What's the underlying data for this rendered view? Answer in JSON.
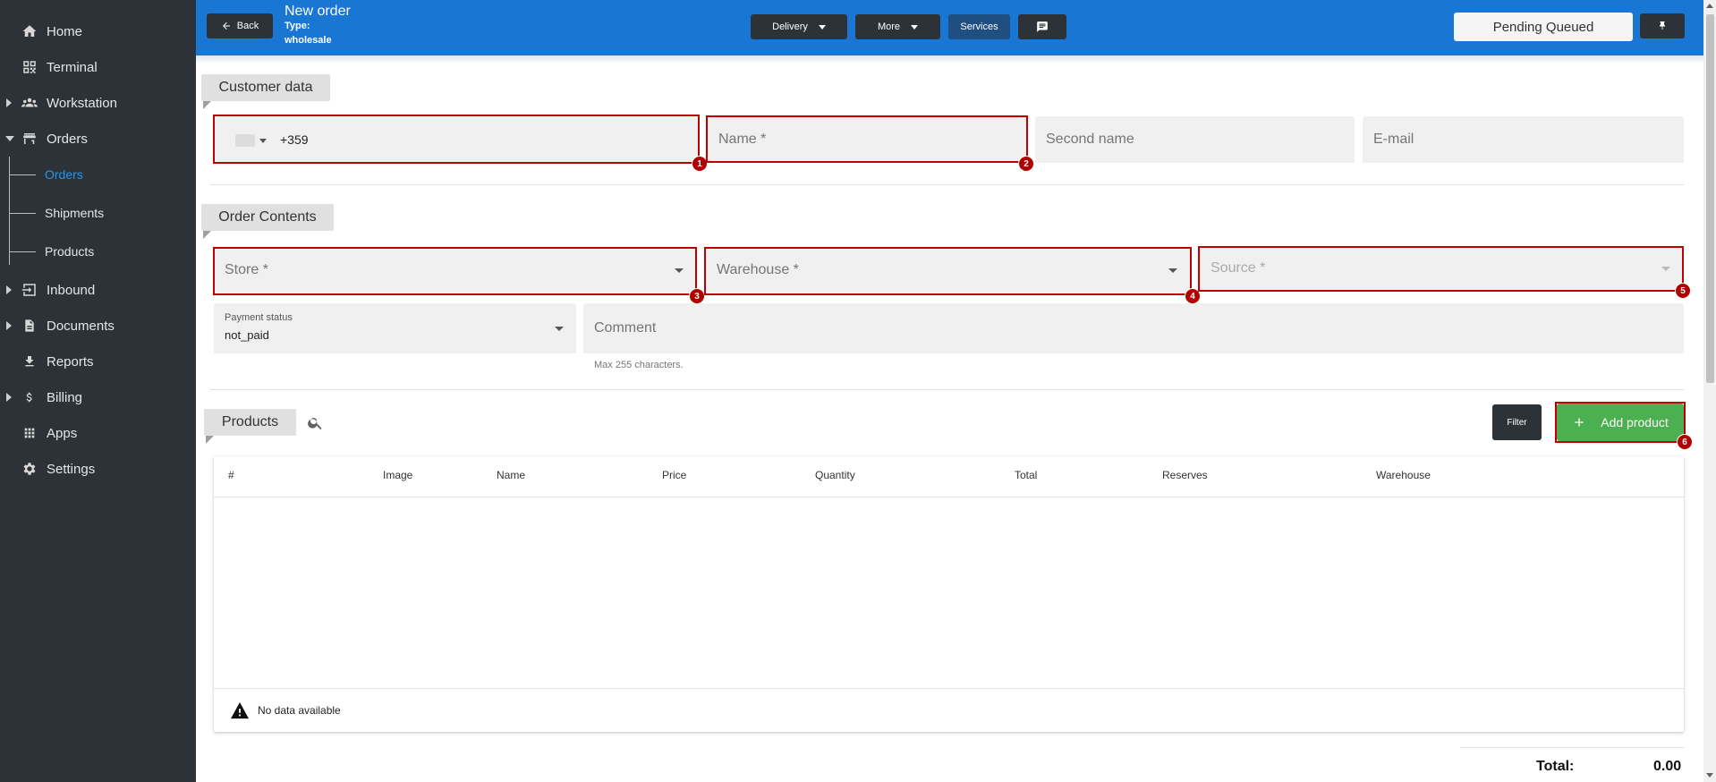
{
  "sidebar": {
    "items": [
      {
        "label": "Home",
        "icon": "home-icon"
      },
      {
        "label": "Terminal",
        "icon": "qr-code-icon"
      },
      {
        "label": "Workstation",
        "icon": "group-icon"
      },
      {
        "label": "Orders",
        "icon": "store-icon"
      },
      {
        "label": "Inbound",
        "icon": "input-icon"
      },
      {
        "label": "Documents",
        "icon": "document-icon"
      },
      {
        "label": "Reports",
        "icon": "download-icon"
      },
      {
        "label": "Billing",
        "icon": "dollar-icon"
      },
      {
        "label": "Apps",
        "icon": "apps-grid-icon"
      },
      {
        "label": "Settings",
        "icon": "gear-icon"
      }
    ],
    "orders_sub": [
      "Orders",
      "Shipments",
      "Products"
    ]
  },
  "topbar": {
    "back_label": "Back",
    "title": "New order",
    "type_label": "Type:",
    "type_value": "wholesale",
    "delivery_label": "Delivery",
    "more_label": "More",
    "services_label": "Services",
    "status": "Pending Queued"
  },
  "customer": {
    "section_title": "Customer data",
    "phone_value": "+359",
    "name_placeholder": "Name *",
    "second_name_placeholder": "Second name",
    "email_placeholder": "E-mail"
  },
  "order_contents": {
    "section_title": "Order Contents",
    "store_placeholder": "Store *",
    "warehouse_placeholder": "Warehouse *",
    "source_placeholder": "Source *",
    "payment_status_label": "Payment status",
    "payment_status_value": "not_paid",
    "comment_placeholder": "Comment",
    "comment_hint": "Max 255 characters."
  },
  "products": {
    "section_title": "Products",
    "filter_label": "Filter",
    "add_label": "Add product",
    "columns": [
      "#",
      "Image",
      "Name",
      "Price",
      "Quantity",
      "Total",
      "Reserves",
      "Warehouse"
    ],
    "empty_text": "No data available",
    "total_label": "Total:",
    "total_value": "0.00"
  },
  "badges": [
    "1",
    "2",
    "3",
    "4",
    "5",
    "6"
  ],
  "colors": {
    "sidebar_bg": "#2d3238",
    "topbar_bg": "#1976d2",
    "accent_link": "#2196f3",
    "highlight": "#c00000",
    "add_button": "#4caf50"
  }
}
